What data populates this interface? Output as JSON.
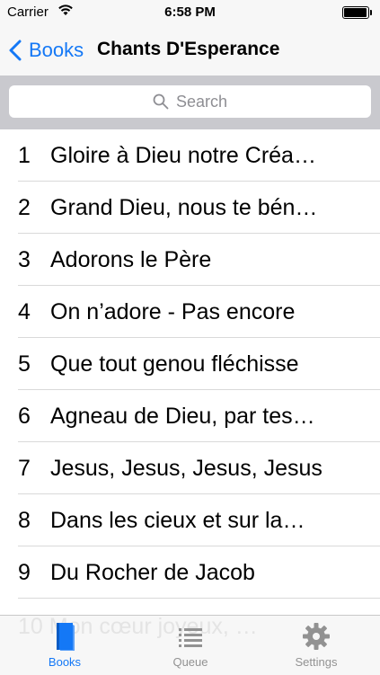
{
  "status_bar": {
    "carrier": "Carrier",
    "time": "6:58 PM",
    "battery_level": 0.95
  },
  "nav": {
    "back_label": "Books",
    "title": "Chants D'Esperance"
  },
  "search": {
    "placeholder": "Search"
  },
  "songs": [
    {
      "number": "1",
      "title": "Gloire à Dieu notre Créa…"
    },
    {
      "number": "2",
      "title": "Grand Dieu, nous te bén…"
    },
    {
      "number": "3",
      "title": "Adorons le Père"
    },
    {
      "number": "4",
      "title": "On n’adore - Pas encore"
    },
    {
      "number": "5",
      "title": "Que tout genou fléchisse"
    },
    {
      "number": "6",
      "title": "Agneau de Dieu, par tes…"
    },
    {
      "number": "7",
      "title": "Jesus, Jesus, Jesus, Jesus"
    },
    {
      "number": "8",
      "title": "Dans les cieux et sur la…"
    },
    {
      "number": "9",
      "title": "Du Rocher de Jacob"
    }
  ],
  "partial_row": "10 Mon cœur joyeux, …",
  "tabs": [
    {
      "label": "Books",
      "icon": "book-icon",
      "active": true
    },
    {
      "label": "Queue",
      "icon": "list-icon",
      "active": false
    },
    {
      "label": "Settings",
      "icon": "gear-icon",
      "active": false
    }
  ],
  "colors": {
    "accent": "#1478f6",
    "inactive_tab": "#929292"
  }
}
